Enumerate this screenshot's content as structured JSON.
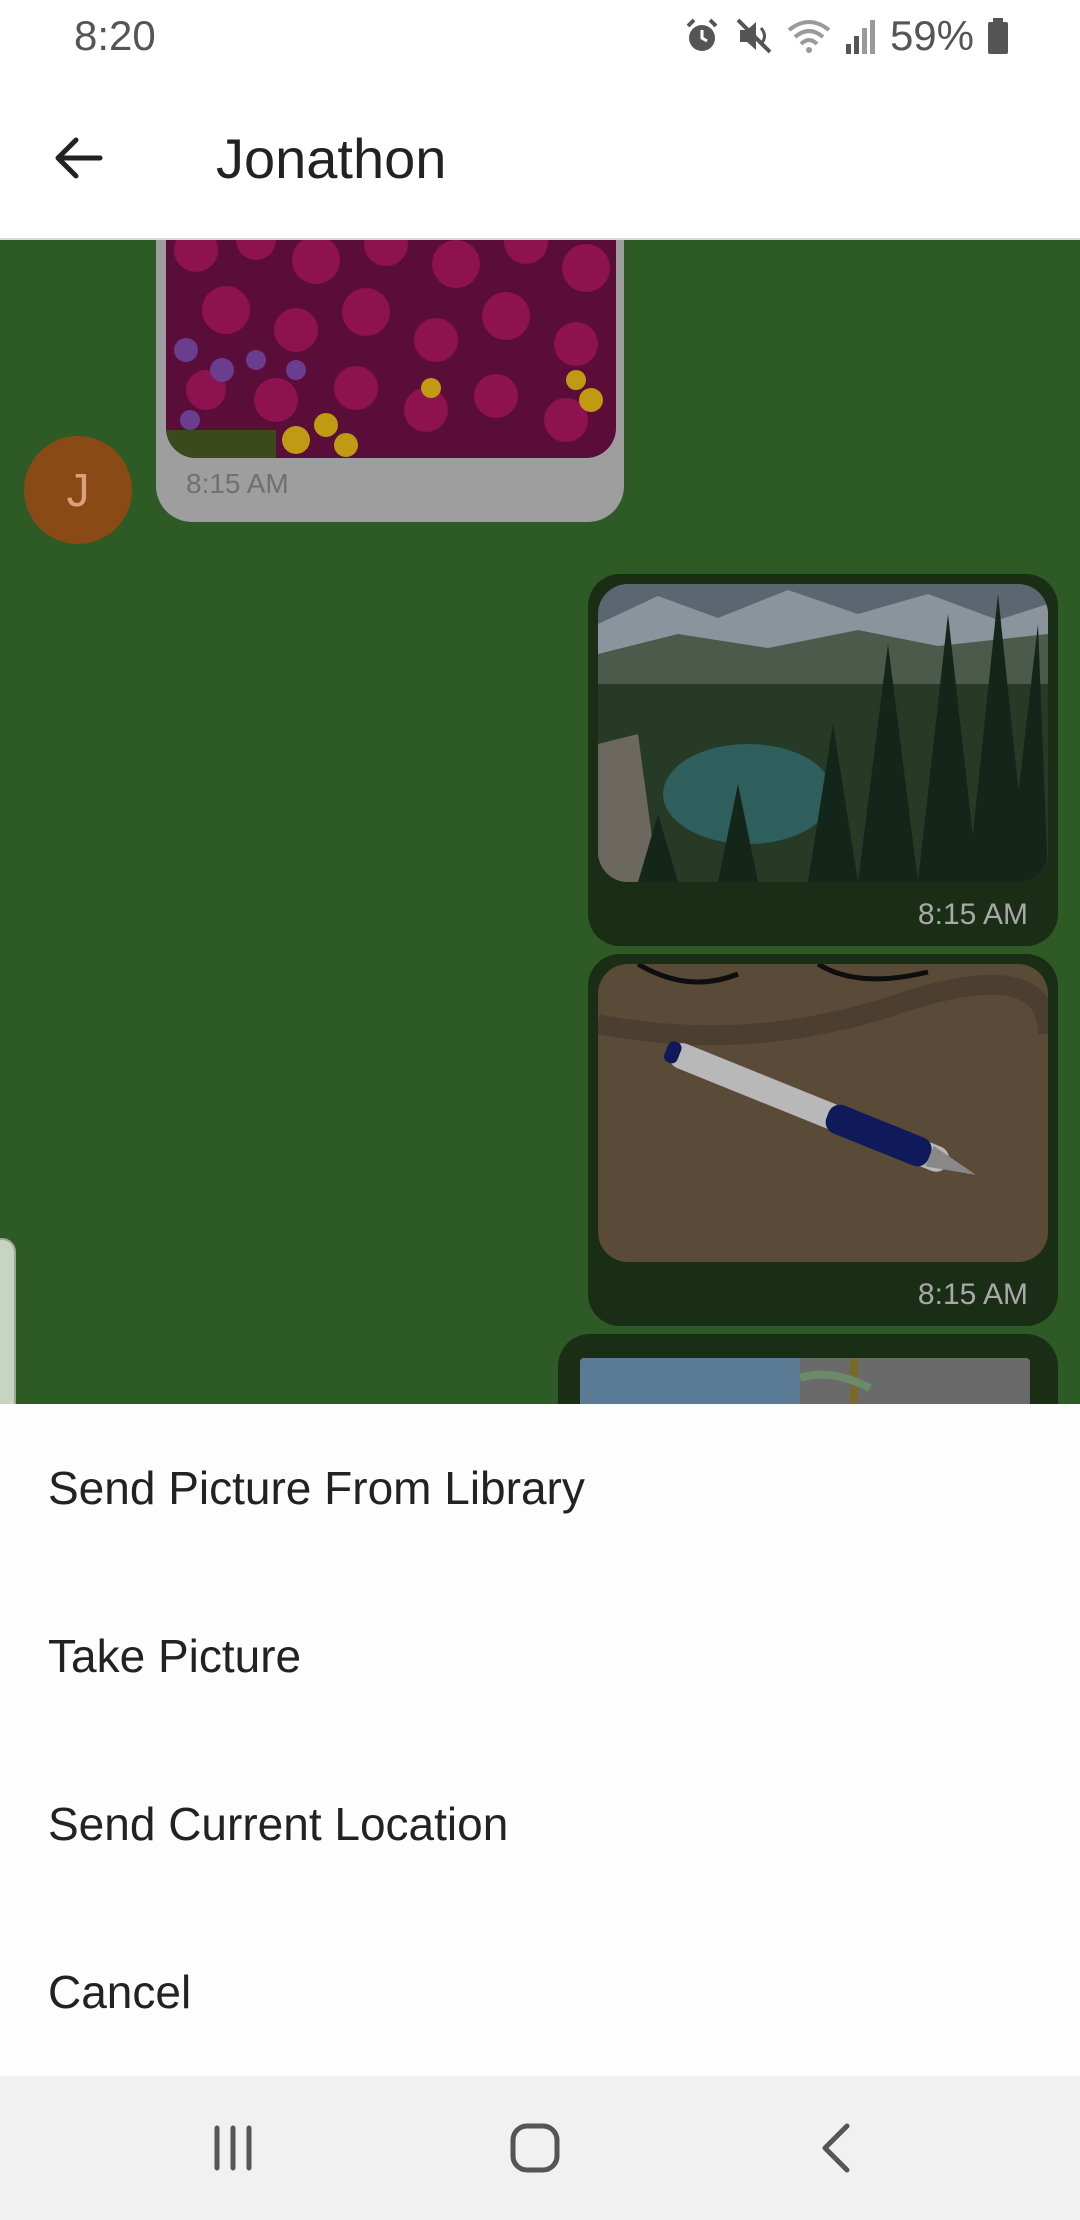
{
  "status_bar": {
    "time": "8:20",
    "battery_text": "59%",
    "icons": [
      "alarm-icon",
      "mute-icon",
      "wifi-icon",
      "signal-icon",
      "battery-icon"
    ]
  },
  "header": {
    "title": "Jonathon",
    "back_icon": "arrow-left-icon"
  },
  "conversation": {
    "avatar_initial": "J",
    "messages": [
      {
        "direction": "incoming",
        "kind": "photo",
        "subject": "flowers",
        "time": "8:15 AM"
      },
      {
        "direction": "outgoing",
        "kind": "photo",
        "subject": "mountain-lake",
        "time": "8:15 AM"
      },
      {
        "direction": "outgoing",
        "kind": "photo",
        "subject": "pen",
        "time": "8:15 AM"
      },
      {
        "direction": "outgoing",
        "kind": "map"
      }
    ]
  },
  "action_sheet": {
    "items": [
      {
        "label": "Send Picture From Library"
      },
      {
        "label": "Take Picture"
      },
      {
        "label": "Send Current Location"
      },
      {
        "label": "Cancel"
      }
    ]
  },
  "nav_bar": {
    "icons": [
      "recent-apps-icon",
      "home-icon",
      "back-icon"
    ]
  },
  "colors": {
    "chat_background": "#2e5a26",
    "outgoing_bubble": "#1a2e16",
    "incoming_bubble": "#9e9e9e",
    "avatar": "#8a4a16"
  }
}
